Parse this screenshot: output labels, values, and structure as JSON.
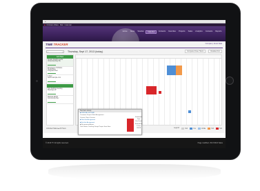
{
  "site": {
    "topbar_items": [
      "Christian Wales",
      "Mail",
      "Calendar"
    ],
    "nav": [
      "Home",
      "News",
      "Sweden",
      "Calendar",
      "Contacts",
      "Favorites",
      "Projects",
      "Sales",
      "Analytics",
      "Contacts",
      "Reports"
    ],
    "active_nav_index": 3
  },
  "app": {
    "brand_main": "TIME",
    "brand_accent": "TRACKER",
    "compare_link": "Compare | Excel Data",
    "date_title": "Thursday, Sept 17, 2013 (today)",
    "filters": [
      "Compare those Hours",
      "Detailed For"
    ],
    "add_button": "Add New",
    "left_items": [
      "Create Joachim-getSt\nUnderstanding the",
      "Emergency Software\nStudio Bug\nIntegrated Sec",
      "1 hour\nwww.example.com",
      "Tom Kuhling meeting\nMeetings all",
      "Website Ethics\nCommunity Dev"
    ]
  },
  "popup": {
    "title": "Test Item Group",
    "rows": [
      "■ SPECIAL HOLIDAY",
      "Customer Project Work Assignment",
      "Current Client Overrun",
      "■ Start the Assignment",
      "■ Exit the Assignment",
      "■ Recommendations",
      "Task Status Tracking Group Project Item Here"
    ],
    "meta": [
      "Estimated",
      "Time",
      "Hrs Used",
      "Estimation",
      "1.5 hrs",
      "3/4/18"
    ]
  },
  "legend": {
    "left": "Unlimited Status  ■ 22 Hours",
    "label": "Legend:",
    "items": [
      {
        "label": "N/A",
        "color": "#d0d0d0"
      },
      {
        "label": "Yes",
        "color": "#4f8fd6"
      },
      {
        "label": "Unlike",
        "color": "#9fc2e8"
      },
      {
        "label": "N/A",
        "color": "#f2994a"
      },
      {
        "label": "N/A",
        "color": "#d8262a"
      }
    ]
  },
  "footer": {
    "left": "© 2013 TT. All rights reserved.",
    "right": "Page modified • 8/17/2013 Sales"
  },
  "colors": {
    "header_purple": "#3f2460",
    "brand_accent": "#d4452b",
    "green": "#3e9b47",
    "blue_block": "#4f8fd6",
    "orange_block": "#f2994a",
    "red_block": "#d8262a"
  }
}
